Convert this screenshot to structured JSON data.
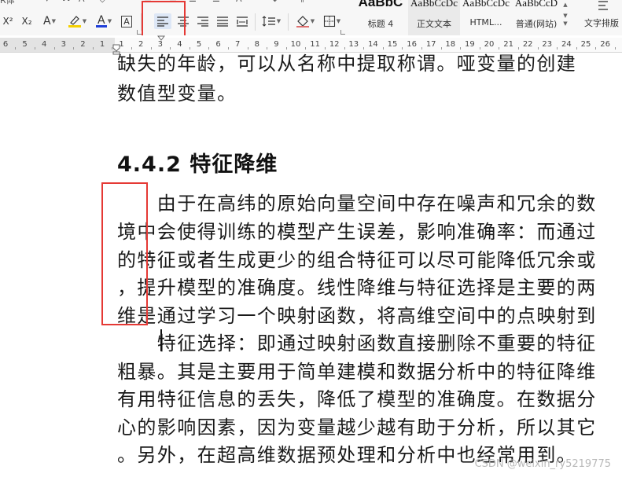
{
  "ribbon": {
    "font_name_fragment": "R体",
    "format_buttons": {
      "superscript": "X²",
      "subscript": "X₂",
      "text_effect": "A",
      "font_color": "A",
      "char_border": "A"
    },
    "styles": [
      {
        "preview": "AaBbC",
        "name": "标题 4",
        "bold": true
      },
      {
        "preview": "AaBbCcDc",
        "name": "正文文本"
      },
      {
        "preview": "AaBbCcDc",
        "name": "HTML..."
      },
      {
        "preview": "AaBbCcD",
        "name": "普通(网站)"
      }
    ],
    "text_layout_label": "文字排版",
    "colors": {
      "highlight": "#f5d000",
      "font_color": "#1f3fd8",
      "accent_box": "#e53935"
    }
  },
  "ruler": {
    "numbers": [
      "6",
      "5",
      "4",
      "3",
      "2",
      "1",
      "1",
      "2",
      "3",
      "4",
      "5",
      "6",
      "7",
      "8",
      "9",
      "10",
      "11",
      "12",
      "13",
      "14",
      "15",
      "16",
      "17",
      "18",
      "19",
      "20",
      "21",
      "22",
      "23",
      "24",
      "25",
      "26"
    ]
  },
  "document": {
    "lines_before": [
      "缺失的年龄，可以从名称中提取称谓。哑变量的创建",
      "数值型变量。"
    ],
    "heading": "4.4.2  特征降维",
    "paragraph_lines": [
      "　　由于在高纬的原始向量空间中存在噪声和冗余的数",
      "境中会使得训练的模型产生误差，影响准确率：而通过",
      "的特征或者生成更少的组合特征可以尽可能降低冗余或",
      "，提升模型的准确度。线性降维与特征选择是主要的两",
      "维是通过学习一个映射函数，将高维空间中的点映射到",
      "　　特征选择：即通过映射函数直接删除不重要的特征",
      "粗暴。其是主要用于简单建模和数据分析中的特征降维",
      "有用特征信息的丢失，降低了模型的准确度。在数据分",
      "心的影响因素，因为变量越少越有助于分析，所以其它",
      "。另外，在超高维数据预处理和分析中也经常用到。"
    ]
  },
  "watermark": "CSDN @weixin_ry5219775"
}
